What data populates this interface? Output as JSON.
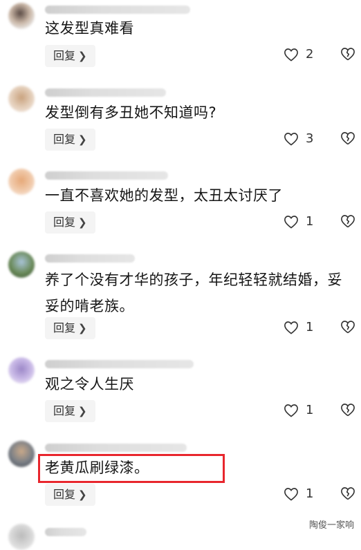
{
  "comments": [
    {
      "text": "这发型真难看",
      "reply_label": "回复",
      "likes": "2",
      "avatar_color": "#d9c7b8"
    },
    {
      "text": "发型倒有多丑她不知道吗?",
      "reply_label": "回复",
      "likes": "3",
      "avatar_color": "#d8b89a"
    },
    {
      "text": "一直不喜欢她的发型，太丑太讨厌了",
      "reply_label": "回复",
      "likes": "1",
      "avatar_color": "#e8b48a"
    },
    {
      "text": "养了个没有才华的孩子，年纪轻轻就结婚，妥妥的啃老族。",
      "reply_label": "回复",
      "likes": "1",
      "avatar_color": "#6a8a5a"
    },
    {
      "text": "观之令人生厌",
      "reply_label": "回复",
      "likes": "1",
      "avatar_color": "#b9a8d8"
    },
    {
      "text": "老黄瓜刷绿漆。",
      "reply_label": "回复",
      "likes": "1",
      "avatar_color": "#7a7f86"
    }
  ],
  "highlight_color": "#e8262d",
  "watermark": "陶俊一家响"
}
